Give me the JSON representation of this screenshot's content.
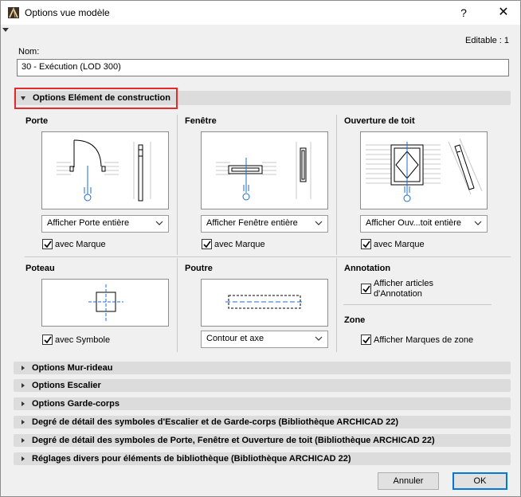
{
  "window": {
    "title": "Options vue modèle",
    "help": "?",
    "close": "✕"
  },
  "editable": "Editable : 1",
  "nom": {
    "label": "Nom:",
    "value": "30 - Exécution (LOD 300)"
  },
  "main_section": {
    "label": "Options Elément de construction"
  },
  "porte": {
    "title": "Porte",
    "dropdown": "Afficher Porte entière",
    "checkbox": "avec Marque",
    "checked": true
  },
  "fenetre": {
    "title": "Fenêtre",
    "dropdown": "Afficher Fenêtre entière",
    "checkbox": "avec Marque",
    "checked": true
  },
  "ouverture": {
    "title": "Ouverture de toit",
    "dropdown": "Afficher Ouv...toit entière",
    "checkbox": "avec Marque",
    "checked": true
  },
  "poteau": {
    "title": "Poteau",
    "checkbox": "avec Symbole",
    "checked": true
  },
  "poutre": {
    "title": "Poutre",
    "dropdown": "Contour et axe"
  },
  "annotation": {
    "title": "Annotation",
    "checkbox_line1": "Afficher articles",
    "checkbox_line2": "d'Annotation",
    "checked": true
  },
  "zone": {
    "title": "Zone",
    "checkbox": "Afficher Marques de zone",
    "checked": true
  },
  "sections": [
    {
      "label": "Options Mur-rideau"
    },
    {
      "label": "Options Escalier"
    },
    {
      "label": "Options Garde-corps"
    },
    {
      "label": "Degré de détail des symboles d'Escalier et de Garde-corps (Bibliothèque ARCHICAD 22)"
    },
    {
      "label": "Degré de détail des symboles de Porte, Fenêtre et Ouverture de toit (Bibliothèque ARCHICAD 22)"
    },
    {
      "label": "Réglages divers pour éléments de bibliothèque (Bibliothèque ARCHICAD 22)"
    }
  ],
  "buttons": {
    "cancel": "Annuler",
    "ok": "OK"
  },
  "colors": {
    "highlight": "#e32b2b",
    "accent_blue": "#1a6fd1",
    "ok_border": "#0078d7"
  }
}
